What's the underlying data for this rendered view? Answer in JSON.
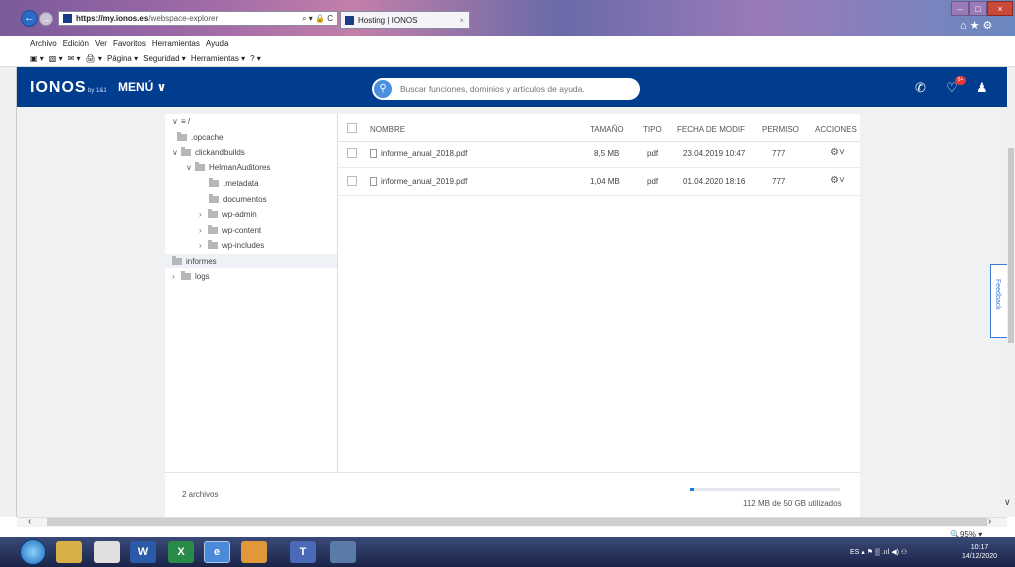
{
  "browser": {
    "url_host": "https://my.ionos.es",
    "url_path": "/webspace-explorer",
    "address_tools": "⌕ ▾ 🔒 C",
    "tab_title": "Hosting | IONOS",
    "tab_close": "×",
    "win_min": "–",
    "win_max": "□",
    "win_close": "×",
    "right_icons": "⌂★⚙",
    "menu": [
      "Archivo",
      "Edición",
      "Ver",
      "Favoritos",
      "Herramientas",
      "Ayuda"
    ],
    "commands": [
      "▣ ▾",
      "▧ ▾",
      "✉ ▾",
      "🖨 ▾",
      "Página ▾",
      "Seguridad ▾",
      "Herramientas ▾",
      "? ▾"
    ],
    "zoom": "🔍95%  ▾"
  },
  "header": {
    "logo": "IONOS",
    "logo_sub": "by 1&1",
    "menu_label": "MENÚ ∨",
    "search_placeholder": "Buscar funciones, dominios y artículos de ayuda.",
    "bell_count": "9+"
  },
  "tree": {
    "root": "≡ /",
    "items": [
      {
        "label": ".opcache",
        "chev": ""
      },
      {
        "label": "clickandbuilds",
        "chev": "∨"
      },
      {
        "label": "HelmanAuditores",
        "chev": "∨"
      },
      {
        "label": ".metadata",
        "chev": ""
      },
      {
        "label": "documentos",
        "chev": ""
      },
      {
        "label": "wp-admin",
        "chev": "›"
      },
      {
        "label": "wp-content",
        "chev": "›"
      },
      {
        "label": "wp-includes",
        "chev": "›"
      },
      {
        "label": "informes",
        "chev": ""
      },
      {
        "label": "logs",
        "chev": "›"
      }
    ]
  },
  "file_list": {
    "columns": {
      "name": "NOMBRE",
      "size": "TAMAÑO",
      "type": "TIPO",
      "date": "FECHA DE MODIF",
      "perm": "PERMISO",
      "actions": "ACCIONES"
    },
    "rows": [
      {
        "name": "informe_anual_2018.pdf",
        "size": "8,5 MB",
        "type": "pdf",
        "date": "23.04.2019 10:47",
        "perm": "777",
        "action_icon": "⚙˅"
      },
      {
        "name": "informe_anual_2019.pdf",
        "size": "1,04 MB",
        "type": "pdf",
        "date": "01.04.2020 18:16",
        "perm": "777",
        "action_icon": "⚙˅"
      }
    ]
  },
  "footer": {
    "file_count": "2 archivos",
    "storage_used": "112 MB de 50 GB utilizados",
    "storage_fraction": 0.0022
  },
  "feedback_label": "Feedback",
  "taskbar": {
    "tray": "ES  ▴  ⚑  ▒  .ııl  ◀)  ⚇",
    "time": "10:17",
    "date": "14/12/2020"
  },
  "colors": {
    "ionos_blue": "#003d8f",
    "accent": "#1f7ae0"
  }
}
